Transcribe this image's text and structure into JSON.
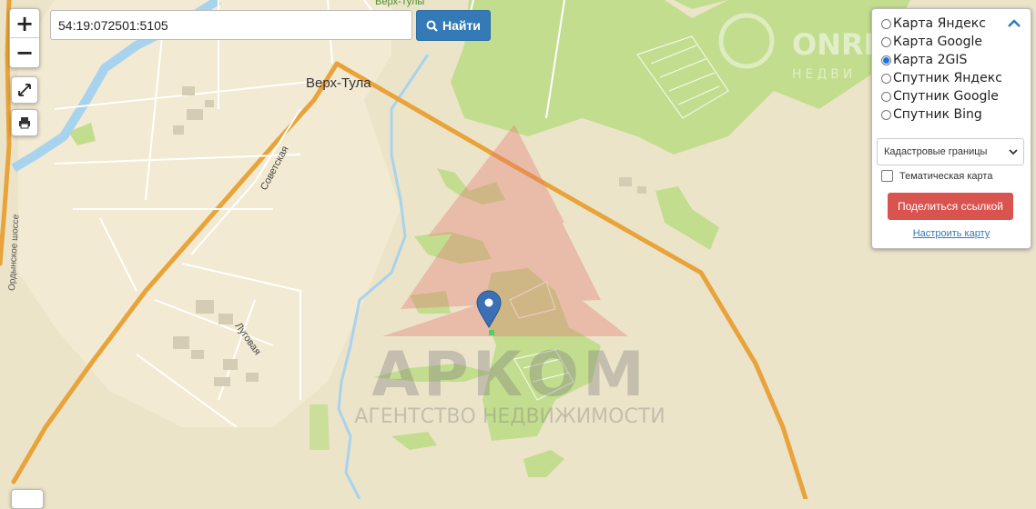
{
  "search": {
    "value": "54:19:072501:5105"
  },
  "find_button": {
    "label": "Найти"
  },
  "map_labels": {
    "village": "Верх-Тула",
    "village_top": "Верх-Тулы",
    "street_sovetskaya": "Советская",
    "street_lugovaya": "Луговая",
    "highway": "Ордынское шоссе"
  },
  "watermark": {
    "brand": "АРКОМ",
    "tagline": "АГЕНТСТВО НЕДВИЖИМОСТИ",
    "corner_brand": "ONREST",
    "corner_sub": "НЕДВИ"
  },
  "layer_panel": {
    "options": [
      {
        "label": "Карта Яндекс",
        "selected": false
      },
      {
        "label": "Карта Google",
        "selected": false
      },
      {
        "label": "Карта 2GIS",
        "selected": true
      },
      {
        "label": "Спутник Яндекс",
        "selected": false
      },
      {
        "label": "Спутник Google",
        "selected": false
      },
      {
        "label": "Спутник Bing",
        "selected": false
      }
    ],
    "layer_select": "Кадастровые границы",
    "thematic_label": "Тематическая карта",
    "share_label": "Поделиться ссылкой",
    "setup_link": "Настроить карту"
  },
  "colors": {
    "map_bg": "#ece4c9",
    "forest": "#c2dc8e",
    "road": "#e8a33a",
    "river": "#a8d3ee",
    "accent_blue": "#337ab7",
    "share_red": "#d9534f"
  }
}
